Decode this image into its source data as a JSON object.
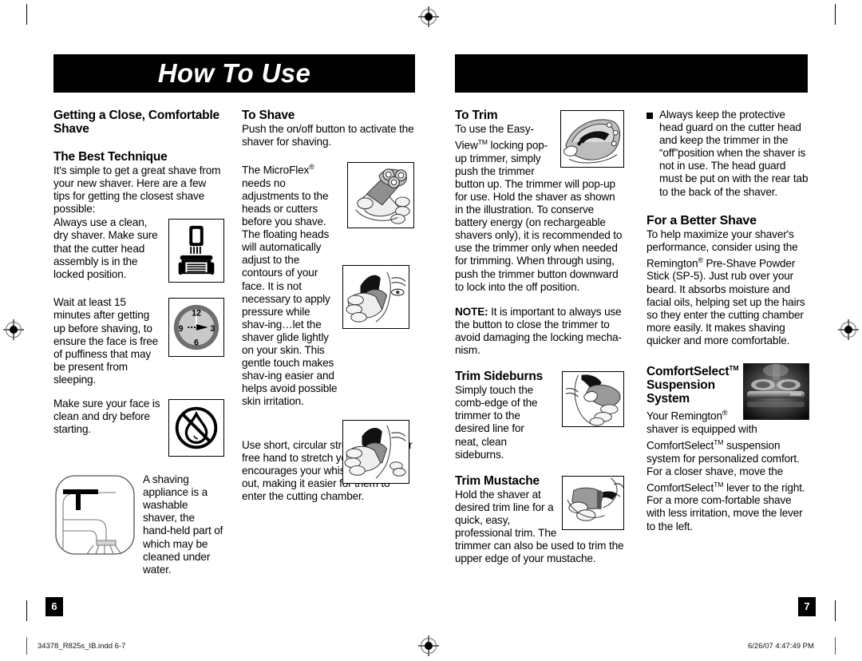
{
  "document": {
    "banner_title": "How To Use",
    "page_left": "6",
    "page_right": "7",
    "footer_file": "34378_R825s_IB.indd   6-7",
    "footer_timestamp": "6/26/07   4:47:49 PM"
  },
  "column1": {
    "heading1": "Getting a Close, Comfortable Shave",
    "heading2": "The Best Technique",
    "para1": "It's simple to get a great shave from your new shaver. Here are a few tips for getting the closest shave possible:",
    "para2": "Always use a clean, dry shaver. Make sure that the cutter head assembly is in the locked position.",
    "para3": "Wait at least 15 minutes after getting up before shaving, to ensure the face is free of puffiness that may be present from sleeping.",
    "para4": "Make sure your face is clean and dry before starting.",
    "para5": "A shaving appliance is a washable shaver, the hand-held part of which may be cleaned under water.",
    "icon1_name": "shaver-in-charging-base-icon",
    "icon2_name": "clock-icon",
    "icon3_name": "no-water-icon",
    "icon4_name": "faucet-running-water-icon",
    "clock_labels": [
      "12",
      "3",
      "6",
      "9"
    ]
  },
  "column2": {
    "heading1": "To Shave",
    "para1": "Push the on/off button to activate the shaver for shaving.",
    "para2_a": "The MicroFlex",
    "para2_b": " needs no adjustments to the heads or cutters before you shave. The floating heads will automatically adjust to the contours of your face. It is not necessary to apply pressure while shav-ing…let the shaver glide lightly on your skin. This gentle touch makes shav-ing easier and helps avoid possible skin irritation.",
    "para3": "Use short, circular strokes. Use your free hand to stretch your skin. This encourages your whiskers to stand out, making it easier for them to enter the cutting chamber.",
    "illus1_name": "hand-holding-shaver-illustration",
    "illus2_name": "shaving-cheek-illustration",
    "illus3_name": "stretching-skin-while-shaving-illustration"
  },
  "column3": {
    "heading1": "To Trim",
    "para1_a": "To use the Easy-View",
    "para1_b": " locking pop-up trimmer, simply push the trimmer button up. The trimmer will pop-up for use. Hold the shaver as shown in the illustration. To conserve battery energy (on rechargeable shavers only), it is recommended to use the trimmer only when needed for trimming. When through using, push the trimmer button downward to lock into the off position.",
    "note_label": "NOTE:",
    "note_text": " It is important to always use the button to close the trimmer to avoid damaging the locking mecha-nism.",
    "heading2": "Trim Sideburns",
    "para2": "Simply touch the comb-edge of the trimmer to the desired line for neat, clean sideburns.",
    "heading3": "Trim Mustache",
    "para3": "Hold the shaver at desired trim line for a quick, easy, professional trim. The trimmer can also be used to trim the upper edge of your mustache.",
    "illus1_name": "pop-up-trimmer-illustration",
    "illus2_name": "trimming-sideburns-illustration",
    "illus3_name": "trimming-neckline-illustration",
    "illus4_name": "trimming-mustache-illustration"
  },
  "column4": {
    "bullet1": "Always keep the protective head guard on the cutter head and keep the trimmer in the “off”position when the shaver is not in use. The head guard must be put on with the rear tab to the back of the shaver.",
    "heading1": "For a Better Shave",
    "para1_a": "To help maximize your shaver's performance, consider using the Remington",
    "para1_b": " Pre-Shave Powder Stick (SP-5). Just rub over your beard. It absorbs moisture and facial oils, helping set up the hairs so they enter the cutting chamber more easily. It makes shaving quicker and more comfortable.",
    "heading2_a": "ComfortSelect",
    "heading2_b": "Suspension System",
    "para2_a": "Your Remington",
    "para2_b": " shaver is equipped with ComfortSelect",
    "para2_c": " suspension system for personalized comfort. For a closer shave, move the ComfortSelect",
    "para2_d": " lever to the right. For a more com-fortable shave with less irritation, move the lever to the left.",
    "photo_name": "comfortselect-suspension-photo"
  },
  "colors": {
    "ink": "#000000",
    "paper": "#ffffff",
    "illustration_gray": "#9b9b9b",
    "illustration_light": "#d8d8d8",
    "mark_gray": "#6a6a6a"
  }
}
